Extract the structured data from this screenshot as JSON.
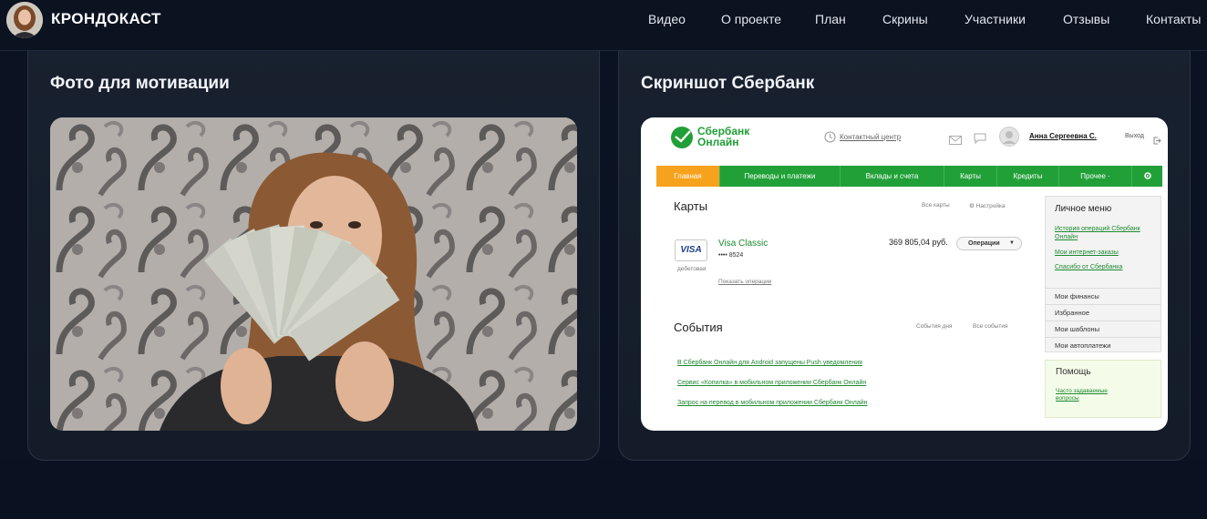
{
  "header": {
    "brand": "КРОНДОКАСТ",
    "nav": [
      "Видео",
      "О проекте",
      "План",
      "Скрины",
      "Участники",
      "Отзывы",
      "Контакты"
    ]
  },
  "cards": {
    "motivation": {
      "title": "Фото для мотивации"
    },
    "sberbank": {
      "title": "Скриншот Сбербанк"
    }
  },
  "sberbank_screen": {
    "logo_line1": "Сбербанк",
    "logo_line2": "Онлайн",
    "contact_center": "Контактный центр",
    "user_name": "Анна Сергеевна С.",
    "exit": "Выход",
    "menu": [
      "Главная",
      "Переводы и платежи",
      "Вклады и счета",
      "Карты",
      "Кредиты",
      "Прочее ·"
    ],
    "cards_heading": "Карты",
    "all_cards": "Все карты",
    "settings": "Настройка",
    "card_brand": "VISA",
    "card_name": "Visa Classic",
    "card_number": "•••• 8524",
    "card_type": "дебетовая",
    "card_balance": "369 805,04 руб.",
    "operations_button": "Операции",
    "show_operations": "Показать операции",
    "events_heading": "События",
    "events_today": "События дня",
    "all_events": "Все события",
    "events": [
      "В Сбербанк Онлайн для Android запущены Push уведомления",
      "Сервис «Копилка» в мобильном приложении Сбербанк Онлайн",
      "Запрос на перевод в мобильном приложении Сбербанк Онлайн"
    ],
    "personal_menu_title": "Личное меню",
    "personal_links": [
      "История операций Сбербанк Онлайн",
      "Мои интернет-заказы",
      "Спасибо от Сбербанка"
    ],
    "side_items": [
      "Мои финансы",
      "Избранное",
      "Мои шаблоны",
      "Мои автоплатежи"
    ],
    "help_title": "Помощь",
    "help_link": "Часто задаваемые вопросы"
  },
  "colors": {
    "page_background": "#0b1222",
    "card_background": "#17202e",
    "sber_green": "#21a038",
    "sber_orange": "#f7a21c"
  }
}
